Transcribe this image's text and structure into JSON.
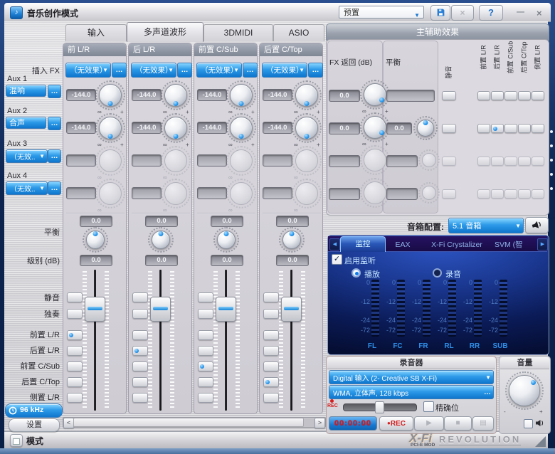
{
  "glyphs": {
    "note": "♪",
    "down": "▼",
    "dots": "…",
    "inf": "∞",
    "plus": "+",
    "minus": "-",
    "left": "<",
    "right": ">",
    "tri_l": "◀",
    "tri_r": "▶",
    "check": "✓",
    "play": "▶",
    "stop": "■",
    "menu": "▤",
    "dot": "●"
  },
  "titlebar": {
    "title": "音乐创作模式",
    "preset": "预置",
    "help": "?",
    "minimize": "—",
    "close": "×",
    "disabled_x": "×"
  },
  "tabs": [
    {
      "label": "输入"
    },
    {
      "label": "多声道波形"
    },
    {
      "label": "3DMIDI"
    },
    {
      "label": "ASIO"
    }
  ],
  "sidebar": {
    "insert_fx": "插入 FX",
    "aux": [
      {
        "label": "Aux 1",
        "value": "混响"
      },
      {
        "label": "Aux 2",
        "value": "合声"
      },
      {
        "label": "Aux 3",
        "value": "（无效.."
      },
      {
        "label": "Aux 4",
        "value": "（无效.."
      }
    ],
    "balance": "平衡",
    "level": "级别 (dB)",
    "mute": "静音",
    "solo": "独奏",
    "routes": [
      "前置 L/R",
      "后置 L/R",
      "前置 C/Sub",
      "后置 C/Top",
      "侧置 L/R"
    ],
    "sample_rate": "96 kHz",
    "settings": "设置"
  },
  "strips": [
    {
      "name": "前 L/R",
      "fx": "（无效果）",
      "aux1": "-144.0",
      "aux2": "-144.0",
      "balance": "0.0",
      "level": "0.0",
      "active_route": 0
    },
    {
      "name": "后 L/R",
      "fx": "（无效果）",
      "aux1": "-144.0",
      "aux2": "-144.0",
      "balance": "0.0",
      "level": "0.0",
      "active_route": 1
    },
    {
      "name": "前置 C/Sub",
      "fx": "（无效果）",
      "aux1": "-144.0",
      "aux2": "-144.0",
      "balance": "0.0",
      "level": "0.0",
      "active_route": 2
    },
    {
      "name": "后置 C/Top",
      "fx": "（无效果）",
      "aux1": "-144.0",
      "aux2": "-144.0",
      "balance": "0.0",
      "level": "0.0",
      "active_route": 3
    }
  ],
  "master": {
    "title": "主辅助效果",
    "fx_return_label": "FX 返回 (dB)",
    "balance_label": "平衡",
    "mute_label": "静音",
    "routes": [
      "前置 L/R",
      "后置 L/R",
      "前置 C/Sub",
      "后置 C/Top",
      "侧置 L/R"
    ],
    "rows": [
      {
        "ret": "0.0",
        "bal": ""
      },
      {
        "ret": "0.0",
        "bal": "0.0"
      },
      {
        "ret": "",
        "bal": ""
      },
      {
        "ret": "",
        "bal": ""
      }
    ]
  },
  "speaker_config": {
    "label": "音箱配置:",
    "value": "5.1 音箱"
  },
  "monitor": {
    "tabs": [
      "监控",
      "EAX",
      "X-Fi Crystalizer",
      "SVM (智"
    ],
    "enable_label": "启用监听",
    "play_label": "播放",
    "record_label": "录音",
    "scale": [
      "0",
      "-12",
      "-24",
      "-72"
    ],
    "channels": [
      "FL",
      "FC",
      "FR",
      "RL",
      "RR",
      "SUB"
    ]
  },
  "recorder": {
    "title": "录音器",
    "input": "Digital 输入 (2- Creative SB X-Fi)",
    "format": "WMA, 立体声, 128 kbps",
    "rec_small": "REC",
    "precise_label": "精确位",
    "timer": "00:00:00",
    "rec_button": "REC"
  },
  "volume": {
    "title": "音量"
  },
  "footer": {
    "mode": "模式",
    "logo": "X-Fi",
    "logo_sub": "PCI-E MOD",
    "brand": "REVOLUTION"
  },
  "colors": {
    "accent_blue": "#1e8ee8",
    "panel_navy": "#0d2b5e",
    "timer_red": "#e01818",
    "meter_label_blue": "#2f8fe8"
  }
}
